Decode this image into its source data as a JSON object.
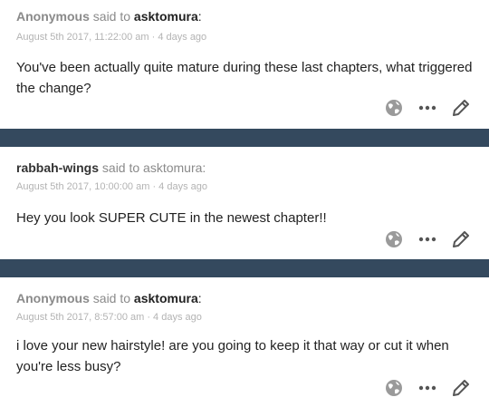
{
  "posts": [
    {
      "asker": "Anonymous",
      "said_to": " said to ",
      "target": "asktomura",
      "colon": ":",
      "timestamp": "August 5th 2017, 11:22:00 am · 4 days ago",
      "message": "You've been actually quite mature during these last chapters, what triggered the change?"
    },
    {
      "asker": "rabbah-wings",
      "said_to": " said to asktomura:",
      "target": "",
      "colon": "",
      "timestamp": "August 5th 2017, 10:00:00 am · 4 days ago",
      "message": "Hey you look SUPER CUTE in the newest chapter!!"
    },
    {
      "asker": "Anonymous",
      "said_to": " said to ",
      "target": "asktomura",
      "colon": ":",
      "timestamp": "August 5th 2017, 8:57:00 am · 4 days ago",
      "message": "i love your new hairstyle! are you going to keep it that way or cut it when you're less busy?"
    }
  ],
  "icons": {
    "globe": "globe-icon",
    "more": "more-icon",
    "edit": "pencil-icon"
  },
  "colors": {
    "separator": "#34495e",
    "icon": "#9a9a9a",
    "timestamp": "#b3b3b3"
  }
}
